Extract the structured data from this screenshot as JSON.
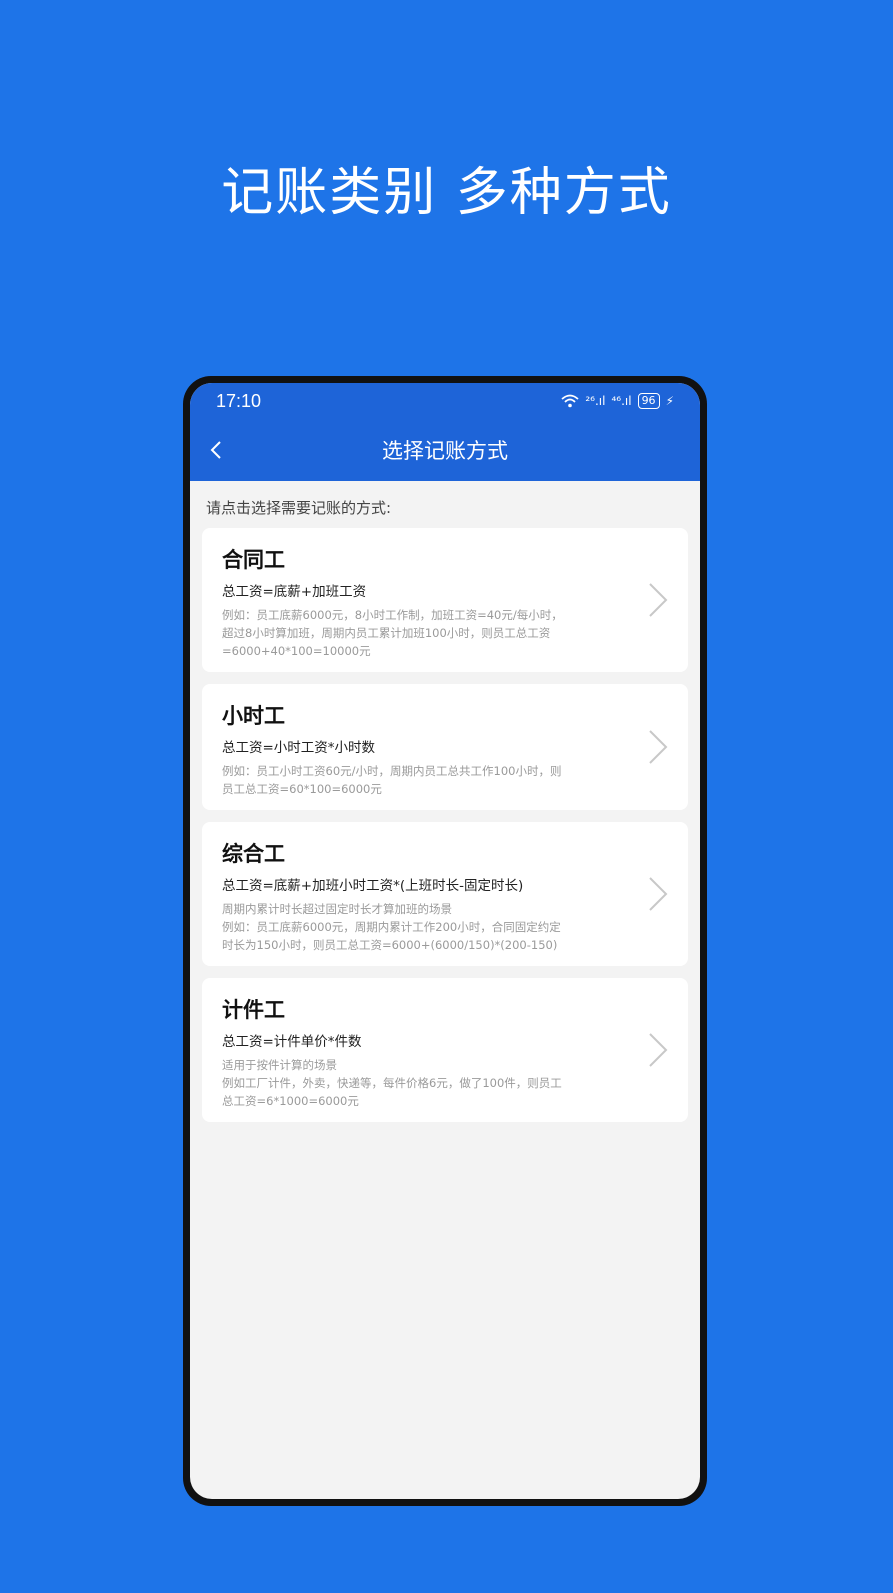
{
  "headline": "记账类别 多种方式",
  "status": {
    "time": "17:10",
    "net1": "²⁶.ıl",
    "net2": "⁴⁶.ıl",
    "battery": "96"
  },
  "appbar": {
    "title": "选择记账方式"
  },
  "hint": "请点击选择需要记账的方式:",
  "cards": [
    {
      "name": "合同工",
      "formula": "总工资=底薪+加班工资",
      "desc": [
        "例如：员工底薪6000元，8小时工作制，加班工资=40元/每小时，",
        "超过8小时算加班，周期内员工累计加班100小时，则员工总工资",
        "=6000+40*100=10000元"
      ]
    },
    {
      "name": "小时工",
      "formula": "总工资=小时工资*小时数",
      "desc": [
        "例如：员工小时工资60元/小时，周期内员工总共工作100小时，则",
        "员工总工资=60*100=6000元"
      ]
    },
    {
      "name": "综合工",
      "formula": "总工资=底薪+加班小时工资*(上班时长-固定时长)",
      "desc": [
        "周期内累计时长超过固定时长才算加班的场景",
        "例如：员工底薪6000元，周期内累计工作200小时，合同固定约定",
        "时长为150小时，则员工总工资=6000+(6000/150)*(200-150)"
      ]
    },
    {
      "name": "计件工",
      "formula": "总工资=计件单价*件数",
      "desc": [
        "适用于按件计算的场景",
        "例如工厂计件，外卖，快递等，每件价格6元，做了100件，则员工",
        "总工资=6*1000=6000元"
      ]
    }
  ]
}
